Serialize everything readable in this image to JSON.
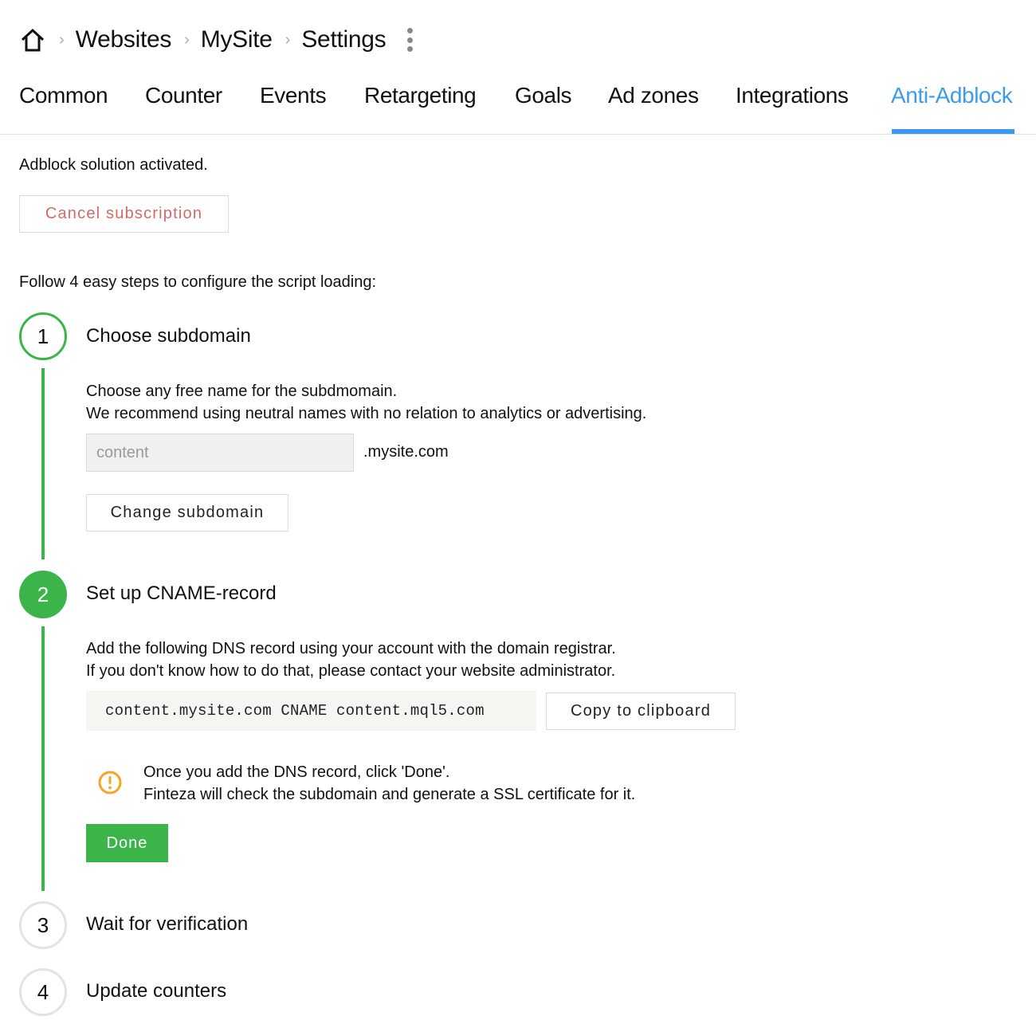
{
  "breadcrumb": {
    "items": [
      "Websites",
      "MySite",
      "Settings"
    ]
  },
  "tabs": [
    {
      "label": "Common",
      "active": false
    },
    {
      "label": "Counter",
      "active": false
    },
    {
      "label": "Events",
      "active": false
    },
    {
      "label": "Retargeting",
      "active": false
    },
    {
      "label": "Goals",
      "active": false
    },
    {
      "label": "Ad zones",
      "active": false
    },
    {
      "label": "Integrations",
      "active": false
    },
    {
      "label": "Anti-Adblock",
      "active": true
    }
  ],
  "status_text": "Adblock solution activated.",
  "cancel_button": "Cancel subscription",
  "intro_text": "Follow 4 easy steps to configure the script loading:",
  "steps": [
    {
      "number": "1",
      "title": "Choose subdomain",
      "state": "done",
      "description": [
        "Choose any free name for the subdmomain.",
        "We recommend using neutral names with no relation to analytics or advertising."
      ],
      "input_value": "content",
      "domain_suffix": ".mysite.com",
      "button": "Change subdomain"
    },
    {
      "number": "2",
      "title": "Set up CNAME-record",
      "state": "current",
      "description": [
        "Add the following DNS record using your account with the domain registrar.",
        "If you don't know how to do that, please contact your website administrator."
      ],
      "dns_record": "content.mysite.com CNAME content.mql5.com",
      "copy_button": "Copy to clipboard",
      "notice": [
        "Once you add the DNS record, click 'Done'.",
        "Finteza will check the subdomain and generate a SSL certificate for it."
      ],
      "done_button": "Done"
    },
    {
      "number": "3",
      "title": "Wait for verification",
      "state": "pending"
    },
    {
      "number": "4",
      "title": "Update counters",
      "state": "pending"
    }
  ],
  "colors": {
    "accent": "#3d9bee",
    "success": "#3bb54a",
    "danger_text": "#d26a66",
    "warning": "#f5a623"
  }
}
